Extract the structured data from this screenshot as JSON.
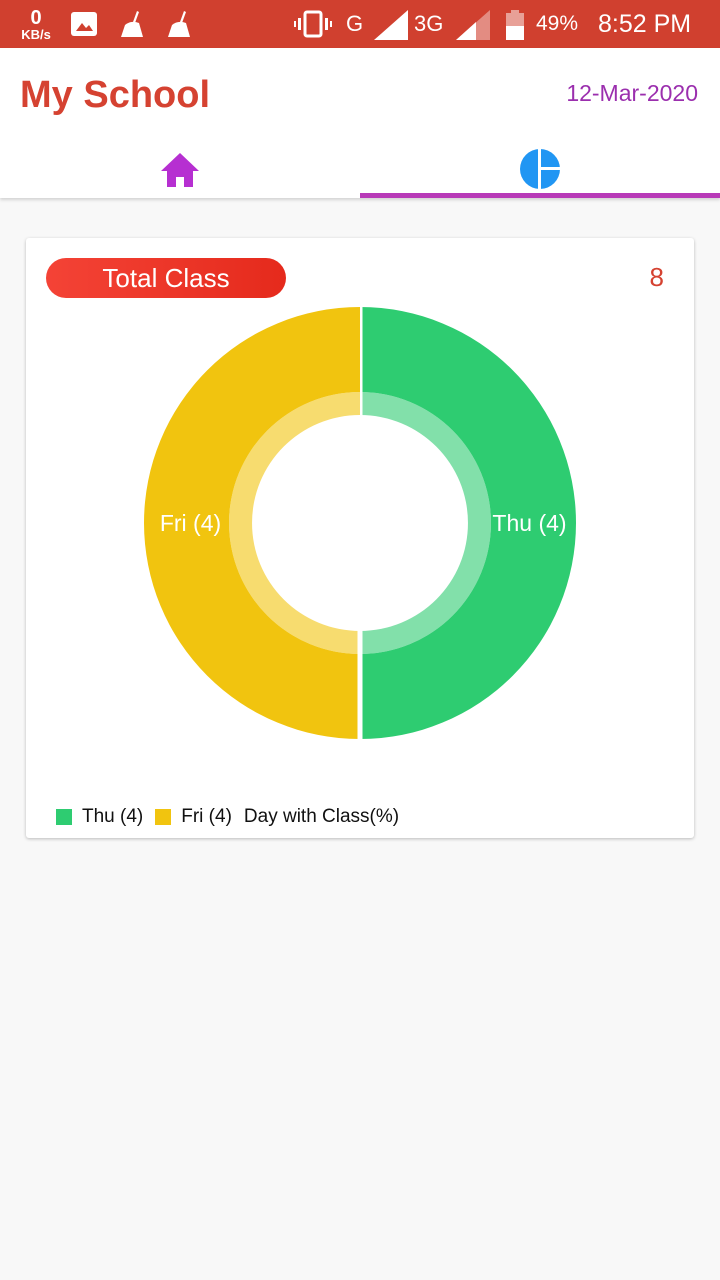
{
  "status_bar": {
    "net_speed_value": "0",
    "net_speed_unit": "KB/s",
    "network_1": "G",
    "network_2": "3G",
    "battery": "49%",
    "time": "8:52 PM",
    "icons": [
      "image-icon",
      "cleaner-icon",
      "cleaner-icon",
      "vibrate-icon",
      "signal-icon",
      "signal-icon",
      "battery-icon"
    ]
  },
  "header": {
    "title": "My School",
    "date": "12-Mar-2020"
  },
  "tabs": [
    {
      "name": "home",
      "icon": "home-icon",
      "selected": false
    },
    {
      "name": "chart",
      "icon": "pie-chart-icon",
      "selected": true
    }
  ],
  "card": {
    "badge_label": "Total Class",
    "total_count": "8"
  },
  "colors": {
    "thu": "#2ecc71",
    "fri": "#f1c40f",
    "accent_red": "#d54231",
    "date_purple": "#9b2fae",
    "tab_indicator": "#b83ab8"
  },
  "chart_data": {
    "type": "pie",
    "style": "donut",
    "title": "Day with Class(%)",
    "slices": [
      {
        "label": "Thu (4)",
        "category": "Thu",
        "value": 4,
        "color": "#2ecc71"
      },
      {
        "label": "Fri (4)",
        "category": "Fri",
        "value": 4,
        "color": "#f1c40f"
      }
    ],
    "legend": {
      "position": "bottom-left",
      "entries": [
        "Thu (4)",
        "Fri (4)"
      ],
      "description": "Day with Class(%)"
    }
  }
}
